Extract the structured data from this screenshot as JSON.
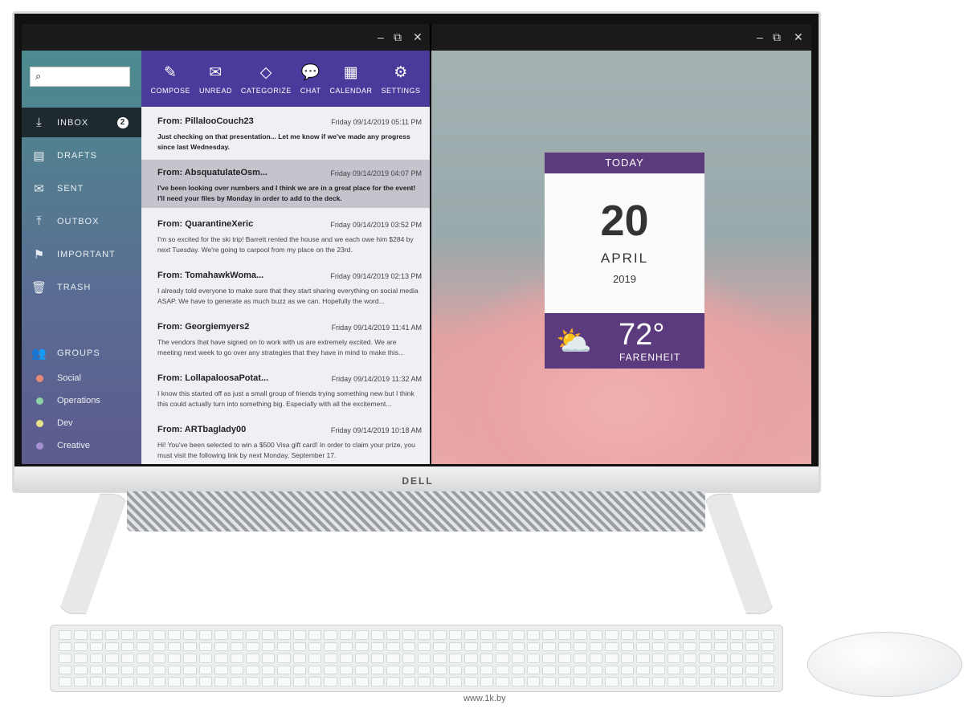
{
  "brand": "DELL",
  "watermark": "www.1k.by",
  "mail_window": {
    "search": {
      "placeholder": ""
    },
    "nav": [
      {
        "label": "INBOX",
        "icon": "inbox-icon",
        "badge": "2",
        "selected": true
      },
      {
        "label": "DRAFTS",
        "icon": "document-icon"
      },
      {
        "label": "SENT",
        "icon": "sent-mail-icon"
      },
      {
        "label": "OUTBOX",
        "icon": "outbox-icon"
      },
      {
        "label": "IMPORTANT",
        "icon": "flag-icon"
      },
      {
        "label": "TRASH",
        "icon": "trash-icon"
      }
    ],
    "groups_label": "GROUPS",
    "groups": [
      {
        "label": "Social",
        "color": "#e88a78"
      },
      {
        "label": "Operations",
        "color": "#8fd1a8"
      },
      {
        "label": "Dev",
        "color": "#e8e38a"
      },
      {
        "label": "Creative",
        "color": "#a58fd1"
      }
    ],
    "toolbar": [
      {
        "label": "COMPOSE",
        "icon": "pencil-icon"
      },
      {
        "label": "UNREAD",
        "icon": "envelope-icon"
      },
      {
        "label": "CATEGORIZE",
        "icon": "tag-icon"
      },
      {
        "label": "CHAT",
        "icon": "chat-icon"
      },
      {
        "label": "CALENDAR",
        "icon": "calendar-icon"
      },
      {
        "label": "SETTINGS",
        "icon": "gear-icon"
      }
    ],
    "emails": [
      {
        "from": "From: PillalooCouch23",
        "date": "Friday 09/14/2019 05:11 PM",
        "body": "Just checking on that presentation... Let me know if we've made any progress since last Wednesday.",
        "unread": true
      },
      {
        "from": "From: AbsquatulateOsm...",
        "date": "Friday 09/14/2019 04:07 PM",
        "body": "I've been looking over numbers and I think we are in a great place for the event! I'll need your files by Monday in order to add to the deck.",
        "unread": true,
        "selected": true
      },
      {
        "from": "From: QuarantineXeric",
        "date": "Friday 09/14/2019 03:52 PM",
        "body": "I'm so excited for the ski trip! Barrett rented the house and we each owe him $284 by next Tuesday. We're going to carpool from my place on the 23rd."
      },
      {
        "from": "From: TomahawkWoma...",
        "date": "Friday 09/14/2019 02:13 PM",
        "body": "I already told everyone to make sure that they start sharing everything on social media ASAP. We have to generate as much buzz as we can. Hopefully the word..."
      },
      {
        "from": "From: Georgiemyers2",
        "date": "Friday 09/14/2019 11:41 AM",
        "body": "The vendors that have signed on to work with us are extremely excited. We are meeting next week to go over any strategies that they have in mind to make this..."
      },
      {
        "from": "From: LollapaloosaPotat...",
        "date": "Friday 09/14/2019 11:32 AM",
        "body": "I know this started off as just a small group of friends trying something new but I think this could actually turn into something big. Especially with all the excitement..."
      },
      {
        "from": "From: ARTbaglady00",
        "date": "Friday 09/14/2019 10:18 AM",
        "body": "Hi! You've been selected to win a $500 Visa gift card! In order to claim your prize, you must visit the following link by next Monday, September 17."
      }
    ]
  },
  "calendar_widget": {
    "header": "TODAY",
    "day": "20",
    "month": "APRIL",
    "year": "2019",
    "temperature": "72°",
    "unit": "FARENHEIT",
    "weather_icon": "partly-cloudy-sun-icon"
  },
  "window_controls": {
    "minimize": "–",
    "restore": "⧉",
    "close": "✕"
  }
}
